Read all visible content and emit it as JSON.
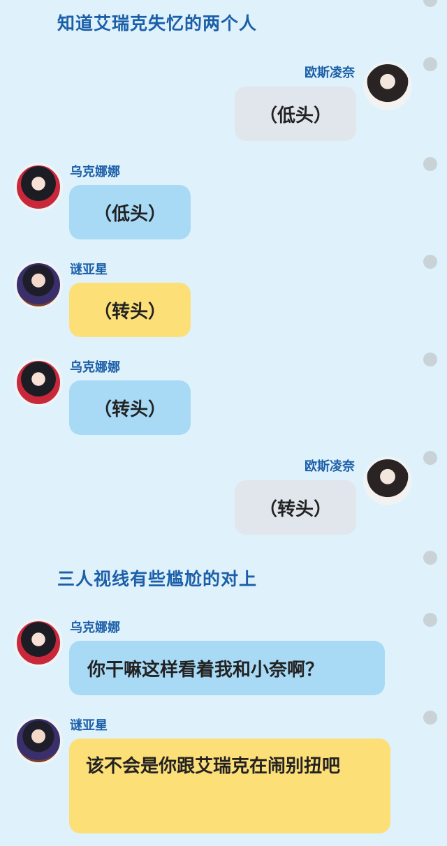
{
  "narration": {
    "top": "知道艾瑞克失忆的两个人",
    "middle": "三人视线有些尴尬的对上"
  },
  "characters": {
    "ousi": "欧斯凌奈",
    "wuke": "乌克娜娜",
    "miya": "谜亚星"
  },
  "messages": [
    {
      "speaker": "欧斯凌奈",
      "text": "（低头）",
      "color": "#e0e6ec"
    },
    {
      "speaker": "乌克娜娜",
      "text": "（低头）",
      "color": "#a8daf6"
    },
    {
      "speaker": "谜亚星",
      "text": "（转头）",
      "color": "#fddf78"
    },
    {
      "speaker": "乌克娜娜",
      "text": "（转头）",
      "color": "#a8daf6"
    },
    {
      "speaker": "欧斯凌奈",
      "text": "（转头）",
      "color": "#e0e6ec"
    },
    {
      "speaker": "乌克娜娜",
      "text": "你干嘛这样看着我和小奈啊？",
      "color": "#a8daf6"
    },
    {
      "speaker": "谜亚星",
      "text": "该不会是你跟艾瑞克在闹别扭吧",
      "color": "#fddf78"
    }
  ],
  "icons": {
    "avatar_ousi": "avatar-girl-dark-hair-icon",
    "avatar_wuke": "avatar-girl-red-uniform-icon",
    "avatar_miya": "avatar-boy-glasses-icon",
    "row_marker": "gray-dot-icon"
  }
}
